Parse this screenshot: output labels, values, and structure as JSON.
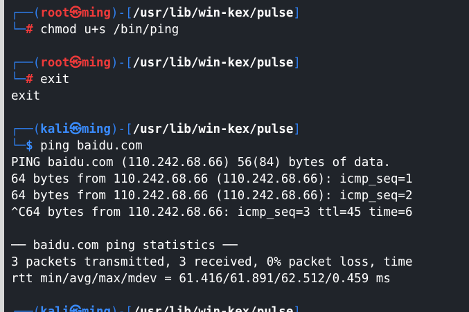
{
  "colors": {
    "background": "#20242a",
    "root_prompt": "#ef3a3a",
    "kali_prompt": "#3a8cff",
    "frame": "#2f7ff0",
    "text": "#ffffff"
  },
  "prompt": {
    "frame_top": "┌──",
    "frame_bottom": "└─",
    "open_paren": "(",
    "close_paren_dash": ")-[",
    "close_bracket": "]",
    "at_symbol": "㉿",
    "host": "ming",
    "path": "/usr/lib/win-kex/pulse",
    "root_user": "root",
    "kali_user": "kali",
    "root_marker": "#",
    "kali_marker": "$"
  },
  "blocks": [
    {
      "user": "root",
      "command": " chmod u+s /bin/ping",
      "output": []
    },
    {
      "user": "root",
      "command": " exit",
      "output": [
        "exit"
      ]
    },
    {
      "user": "kali",
      "command": " ping baidu.com",
      "output": [
        "PING baidu.com (110.242.68.66) 56(84) bytes of data.",
        "64 bytes from 110.242.68.66 (110.242.68.66): icmp_seq=1",
        "64 bytes from 110.242.68.66 (110.242.68.66): icmp_seq=2",
        "^C64 bytes from 110.242.68.66: icmp_seq=3 ttl=45 time=6",
        "",
        "── baidu.com ping statistics ──",
        "3 packets transmitted, 3 received, 0% packet loss, time",
        "rtt min/avg/max/mdev = 61.416/61.891/62.512/0.459 ms"
      ]
    }
  ],
  "partial_prompt_user": "kali"
}
